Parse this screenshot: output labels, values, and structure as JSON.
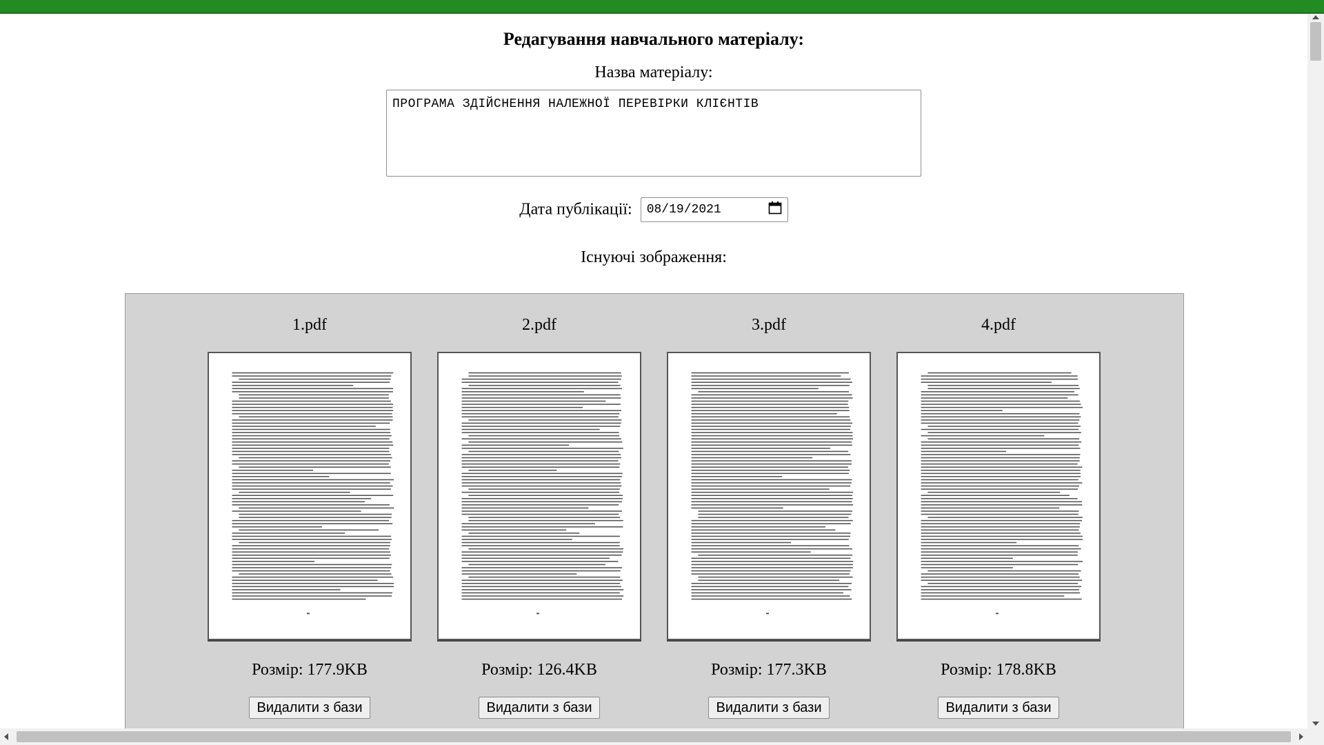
{
  "page_title": "Редагування навчального матеріалу:",
  "material_name": {
    "label": "Назва матеріалу:",
    "value": "ПРОГРАМА ЗДІЙСНЕННЯ НАЛЕЖНОЇ ПЕРЕВІРКИ КЛІЄНТІВ"
  },
  "publication_date": {
    "label": "Дата публікації:",
    "value": "08/19/2021",
    "icon": "calendar-icon"
  },
  "existing_images": {
    "label": "Існуючі зображення:",
    "items": [
      {
        "file": "1.pdf",
        "size": "Розмір: 177.9KB",
        "delete_label": "Видалити з бази"
      },
      {
        "file": "2.pdf",
        "size": "Розмір: 126.4KB",
        "delete_label": "Видалити з бази"
      },
      {
        "file": "3.pdf",
        "size": "Розмір: 177.3KB",
        "delete_label": "Видалити з бази"
      },
      {
        "file": "4.pdf",
        "size": "Розмір: 178.8KB",
        "delete_label": "Видалити з бази"
      }
    ]
  },
  "colors": {
    "top_bar": "#228b22",
    "gallery_bg": "#d3d3d3",
    "button_bg": "#efefef"
  }
}
